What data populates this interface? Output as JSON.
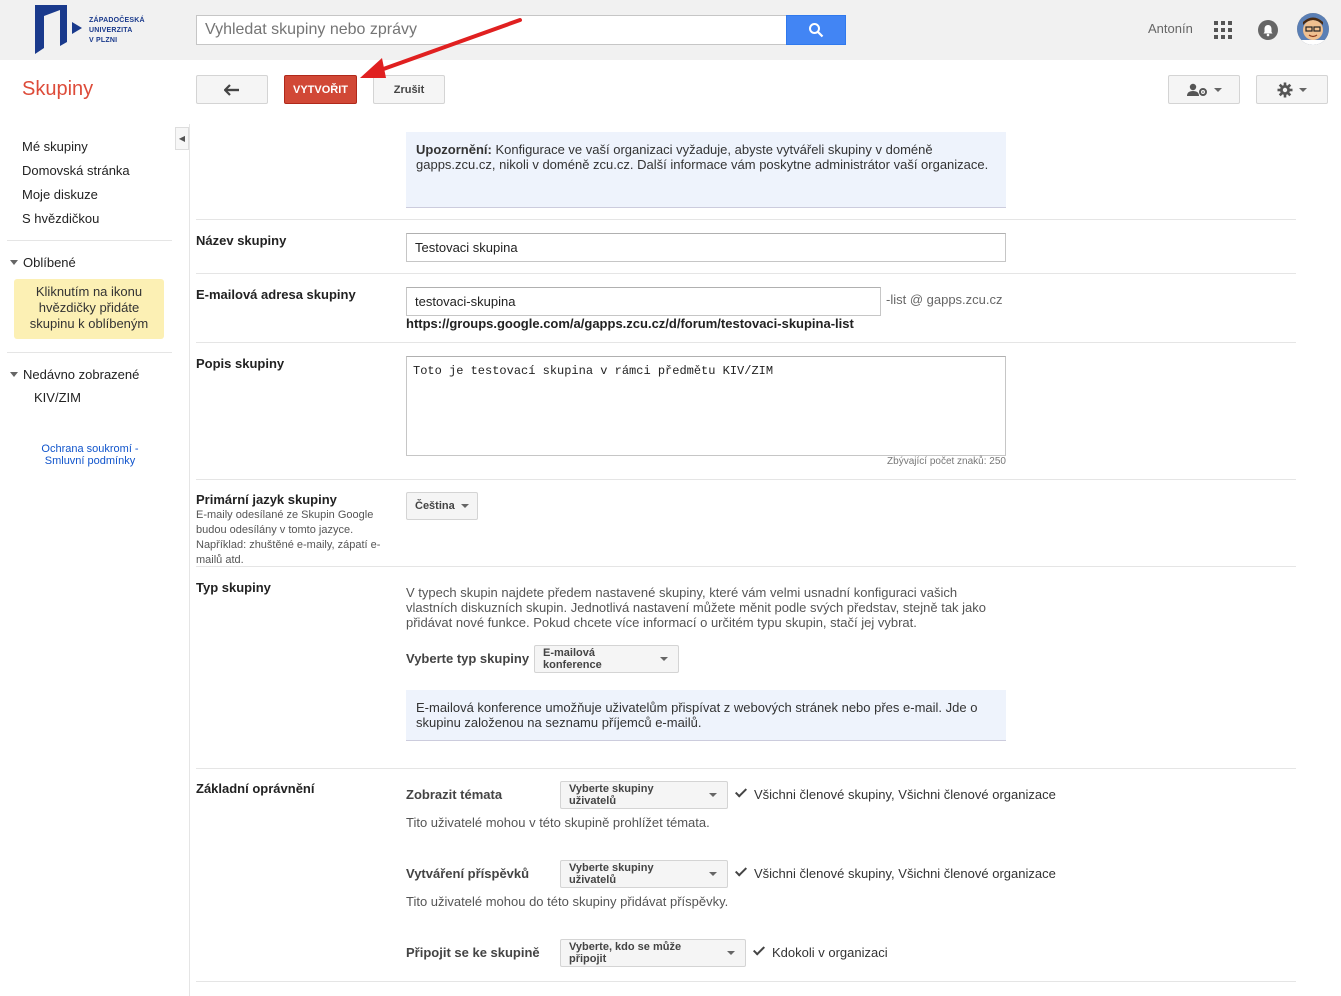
{
  "header": {
    "logo_text": [
      "ZÁPADOČESKÁ",
      "UNIVERZITA",
      "V PLZNI"
    ],
    "search_placeholder": "Vyhledat skupiny nebo zprávy",
    "user_name": "Antonín"
  },
  "toolbar": {
    "app_name": "Skupiny",
    "create_label": "VYTVOŘIT",
    "cancel_label": "Zrušit"
  },
  "sidebar": {
    "items": [
      {
        "label": "Mé skupiny"
      },
      {
        "label": "Domovská stránka"
      },
      {
        "label": "Moje diskuze"
      },
      {
        "label": "S hvězdičkou"
      }
    ],
    "favorites_label": "Oblíbené",
    "favorites_note": "Kliknutím na ikonu hvězdičky přidáte skupinu k oblíbeným",
    "recent_label": "Nedávno zobrazené",
    "recent_items": [
      "KIV/ZIM"
    ],
    "privacy_link": "Ochrana soukromí",
    "terms_link": "Smluvní podmínky"
  },
  "form": {
    "warning_title": "Upozornění:",
    "warning_text": " Konfigurace ve vaší organizaci vyžaduje, abyste vytvářeli skupiny v doméně gapps.zcu.cz, nikoli v doméně zcu.cz. Další informace vám poskytne administrátor vaší organizace.",
    "name_label": "Název skupiny",
    "name_value": "Testovaci skupina",
    "email_label": "E-mailová adresa skupiny",
    "email_value": "testovaci-skupina",
    "email_suffix": "-list @ gapps.zcu.cz",
    "group_url": "https://groups.google.com/a/gapps.zcu.cz/d/forum/testovaci-skupina-list",
    "desc_label": "Popis skupiny",
    "desc_value": "Toto je testovací skupina v rámci předmětu KIV/ZIM",
    "char_count": "Zbývající počet znaků: 250",
    "lang_label": "Primární jazyk skupiny",
    "lang_sub": "E-maily odesílané ze Skupin Google budou odesílány v tomto jazyce. Například: zhuštěné e-maily, zápatí e-mailů atd.",
    "lang_value": "Čeština",
    "type_label": "Typ skupiny",
    "type_desc": "V typech skupin najdete předem nastavené skupiny, které vám velmi usnadní konfiguraci vašich vlastních diskuzních skupin. Jednotlivá nastavení můžete měnit podle svých představ, stejně tak jako přidávat nové funkce. Pokud chcete více informací o určitém typu skupin, stačí jej vybrat.",
    "type_select_label": "Vyberte typ skupiny",
    "type_select_value": "E-mailová konference",
    "type_info": "E-mailová konference umožňuje uživatelům přispívat z webových stránek nebo přes e-mail. Jde o skupinu založenou na seznamu příjemců e-mailů.",
    "perms_label": "Základní oprávnění"
  },
  "permissions": [
    {
      "label": "Zobrazit témata",
      "select": "Vyberte skupiny uživatelů",
      "value": "Všichni členové skupiny, Všichni členové organizace",
      "desc": "Tito uživatelé mohou v této skupině prohlížet témata."
    },
    {
      "label": "Vytváření příspěvků",
      "select": "Vyberte skupiny uživatelů",
      "value": "Všichni členové skupiny, Všichni členové organizace",
      "desc": "Tito uživatelé mohou do této skupiny přidávat příspěvky."
    },
    {
      "label": "Připojit se ke skupině",
      "select": "Vyberte, kdo se může připojit",
      "value": "Kdokoli v organizaci",
      "desc": ""
    }
  ],
  "colors": {
    "accent_red": "#d14836",
    "app_name_red": "#dd4b39",
    "search_blue": "#4285f4",
    "info_bg": "#eef3fc",
    "note_yellow": "#fcf0b4",
    "link_blue": "#1155cc"
  },
  "icons": [
    "university-logo",
    "search-icon",
    "apps-grid-icon",
    "notifications-icon",
    "avatar",
    "back-arrow-icon",
    "people-settings-icon",
    "gear-icon",
    "collapse-chevron-icon",
    "checkmark-icon",
    "red-pointer-arrow"
  ]
}
